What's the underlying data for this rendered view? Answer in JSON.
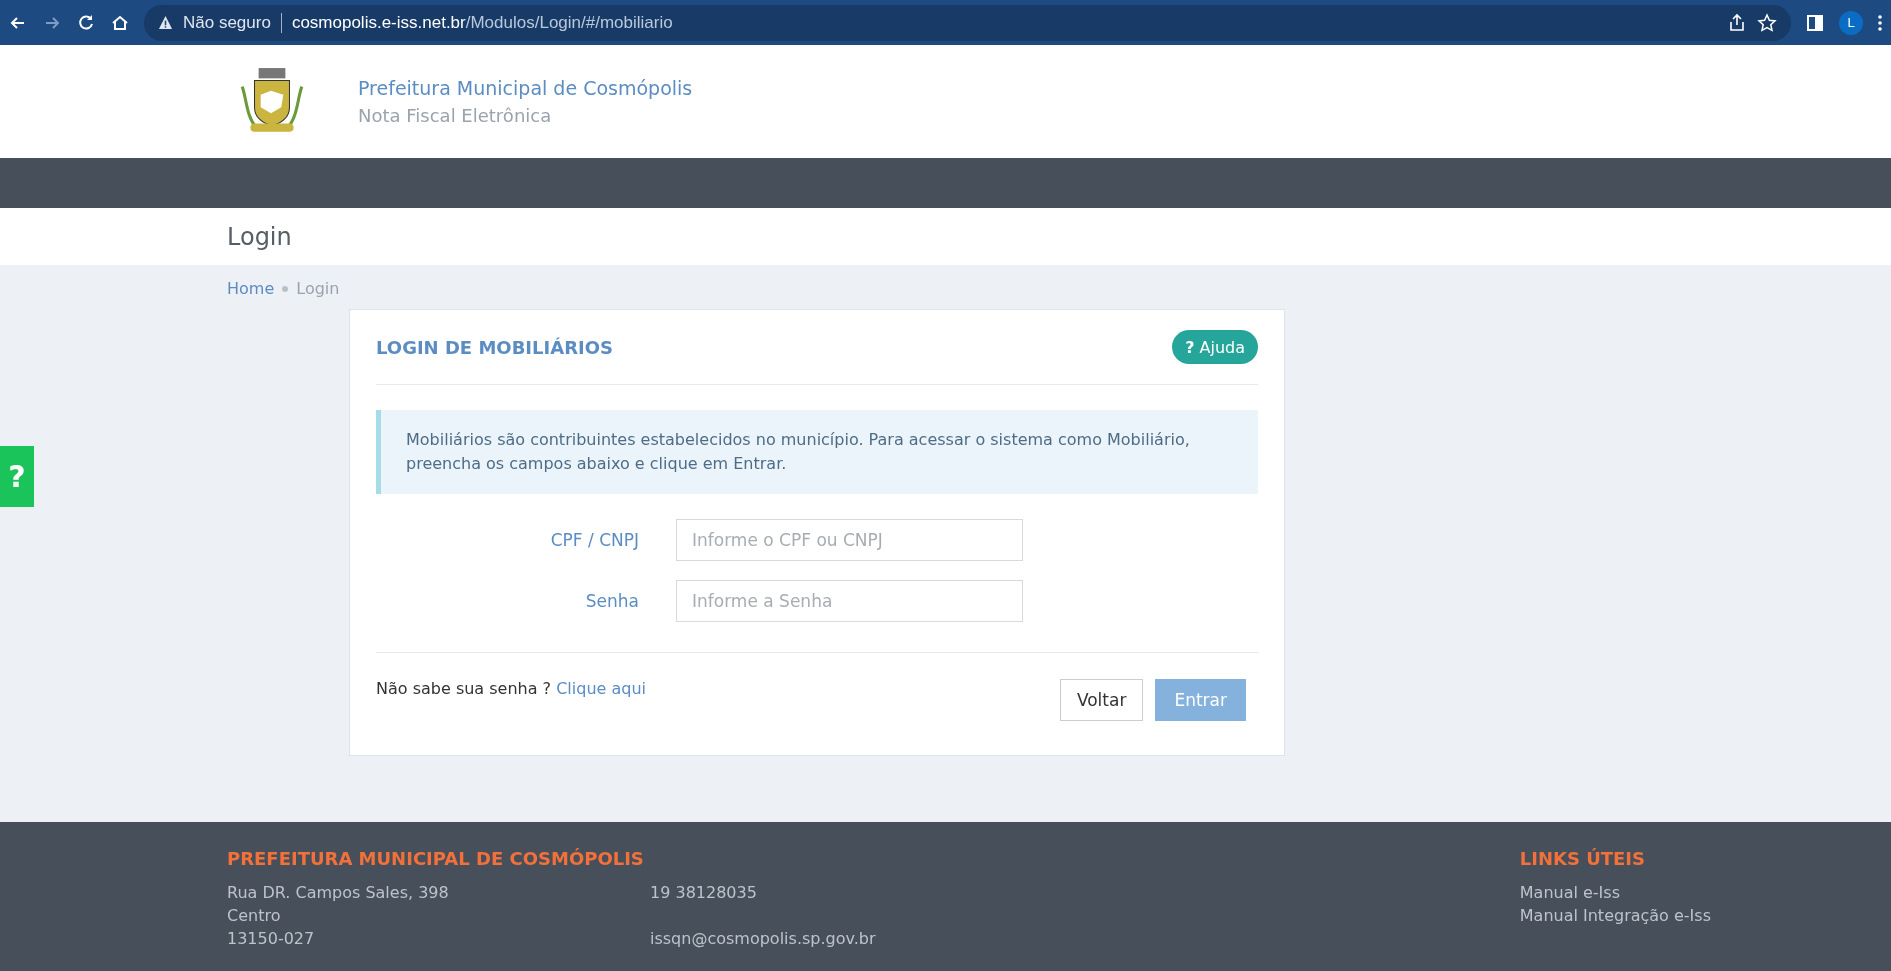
{
  "browser": {
    "security": "Não seguro",
    "url_host": "cosmopolis.e-iss.net.br",
    "url_path": "/Modulos/Login/#/mobiliario",
    "profile": "L"
  },
  "header": {
    "title": "Prefeitura Municipal de Cosmópolis",
    "subtitle": "Nota Fiscal Eletrônica"
  },
  "page_title": "Login",
  "breadcrumb": [
    {
      "label": "Home",
      "selected": false
    },
    {
      "label": "Login",
      "selected": true
    }
  ],
  "help_tab": {
    "label": "?"
  },
  "card": {
    "title": "LOGIN DE MOBILIÁRIOS",
    "help_button": {
      "icon": "?",
      "label": "Ajuda"
    },
    "info": "Mobiliários são contribuintes estabelecidos no município. Para acessar o sistema como Mobiliário, preencha os campos abaixo e clique em Entrar.",
    "fields": [
      {
        "label": "CPF / CNPJ",
        "placeholder": "Informe o CPF ou CNPJ"
      },
      {
        "label": "Senha",
        "placeholder": "Informe a Senha"
      }
    ],
    "forgot_text": "Não sabe sua senha ?",
    "forgot_link": "Clique aqui",
    "buttons": [
      {
        "label": "Voltar",
        "kind": "default",
        "disabled": false
      },
      {
        "label": "Entrar",
        "kind": "primary",
        "disabled": true
      }
    ]
  },
  "footer": {
    "title": "PREFEITURA MUNICIPAL DE COSMÓPOLIS",
    "address": [
      "Rua DR. Campos Sales, 398",
      "Centro",
      "13150-027"
    ],
    "phone": "19 38128035",
    "email": "issqn@cosmopolis.sp.gov.br",
    "links_title": "LINKS ÚTEIS",
    "links": [
      "Manual e-Iss",
      "Manual Integração e-Iss"
    ]
  }
}
